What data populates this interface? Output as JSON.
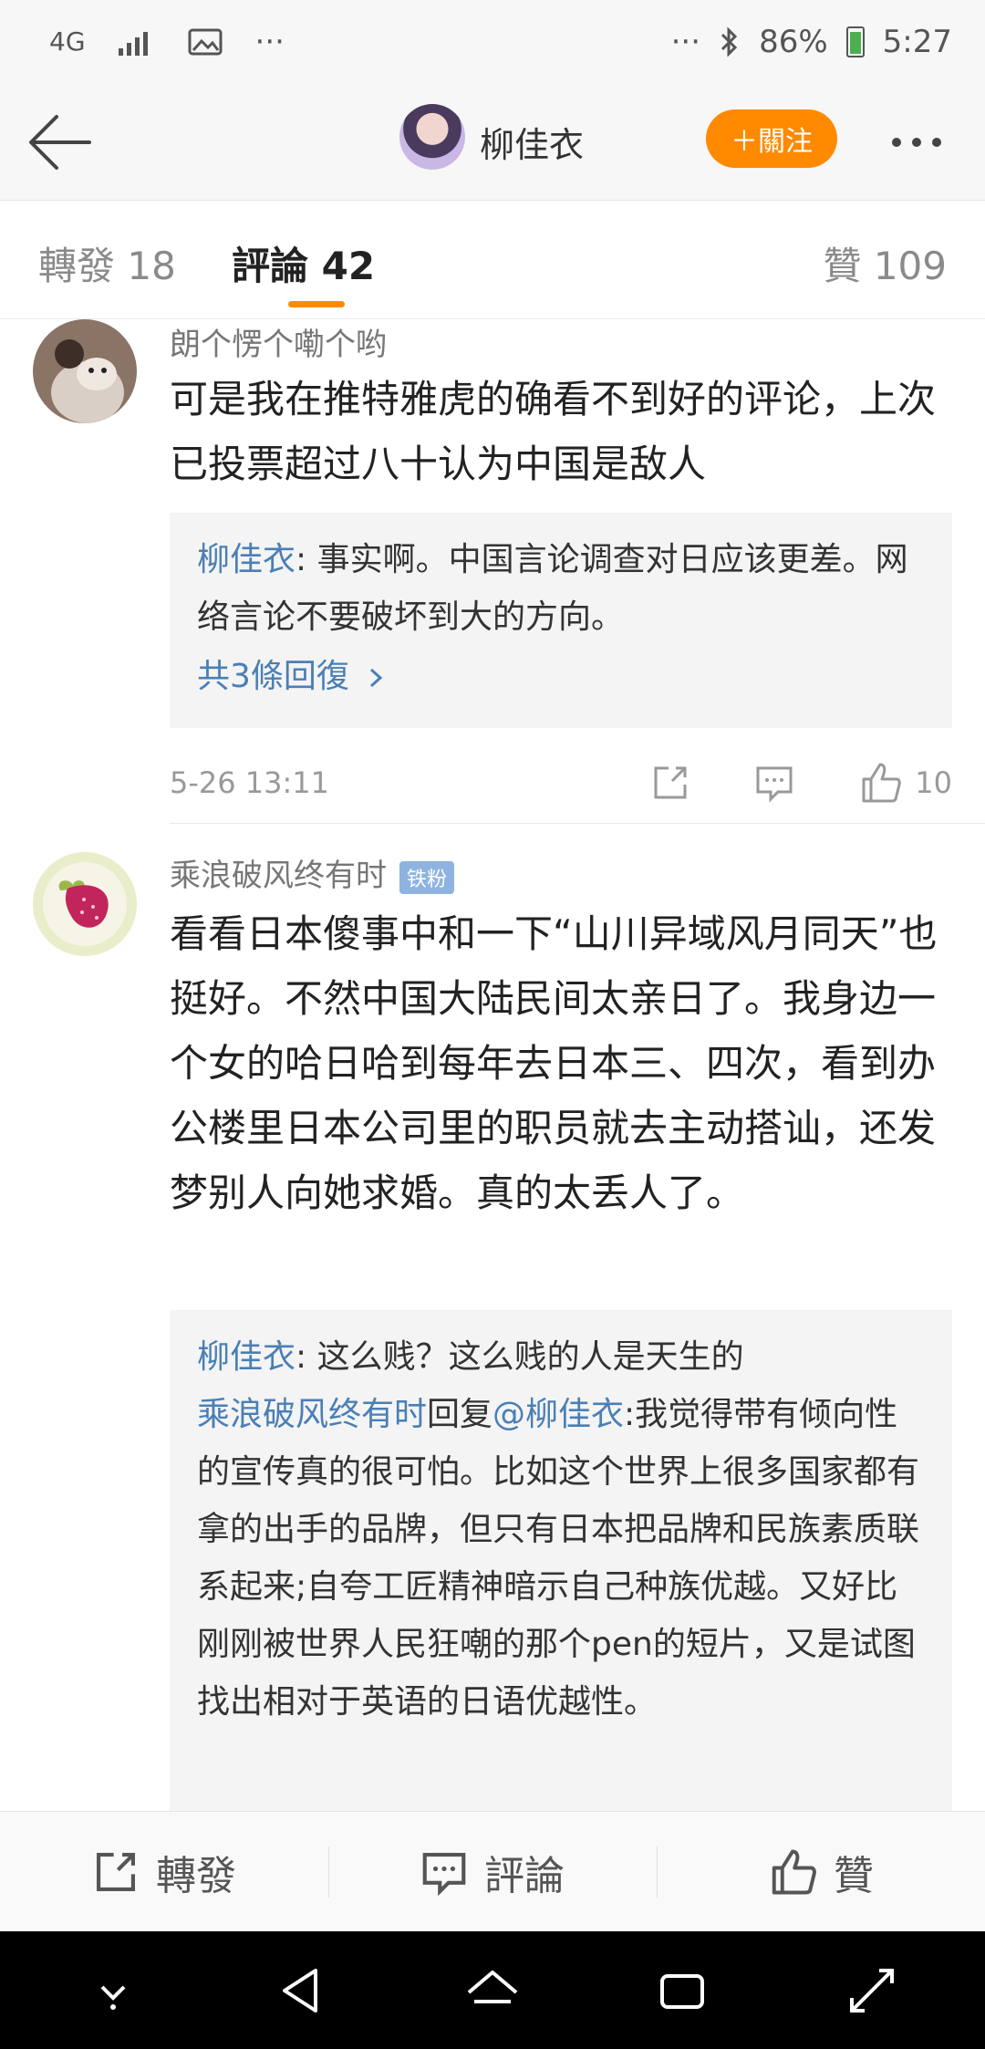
{
  "status_bar": {
    "network": "4G",
    "more_left": "···",
    "more_right": "···",
    "battery": "86%",
    "time": "5:27"
  },
  "header": {
    "title": "柳佳衣",
    "follow_label": "＋關注"
  },
  "tabs": {
    "repost": "轉發 18",
    "comments": "評論 42",
    "likes": "贊 109"
  },
  "comments": [
    {
      "username": "朗个愣个嘞个哟",
      "text": "可是我在推特雅虎的确看不到好的评论，上次已投票超过八十认为中国是敌人",
      "reply": {
        "author": "柳佳衣",
        "text": ": 事实啊。中国言论调查对日应该更差。网络言论不要破坏到大的方向。",
        "more": "共3條回復"
      },
      "time": "5-26 13:11",
      "likes": "10"
    },
    {
      "username": "乘浪破风终有时",
      "badge": "铁粉",
      "text": "看看日本傻事中和一下“山川异域风月同天”也挺好。不然中国大陆民间太亲日了。我身边一个女的哈日哈到每年去日本三、四次，看到办公楼里日本公司里的职员就去主动搭讪，还发梦别人向她求婚。真的太丢人了。",
      "reply": {
        "author": "柳佳衣",
        "text": ": 这么贱？这么贱的人是天生的",
        "author2": "乘浪破风终有时",
        "mid": "回复",
        "mention": "@柳佳衣",
        "text2": ":我觉得带有倾向性的宣传真的很可怕。比如这个世界上很多国家都有拿的出手的品牌，但只有日本把品牌和民族素质联系起来;自夸工匠精神暗示自己种族优越。又好比刚刚被世界人民狂嘲的那个pen的短片，又是试图找出相对于英语的日语优越性。"
      }
    }
  ],
  "action_bar": {
    "repost": "轉發",
    "comment": "評論",
    "like": "贊"
  }
}
